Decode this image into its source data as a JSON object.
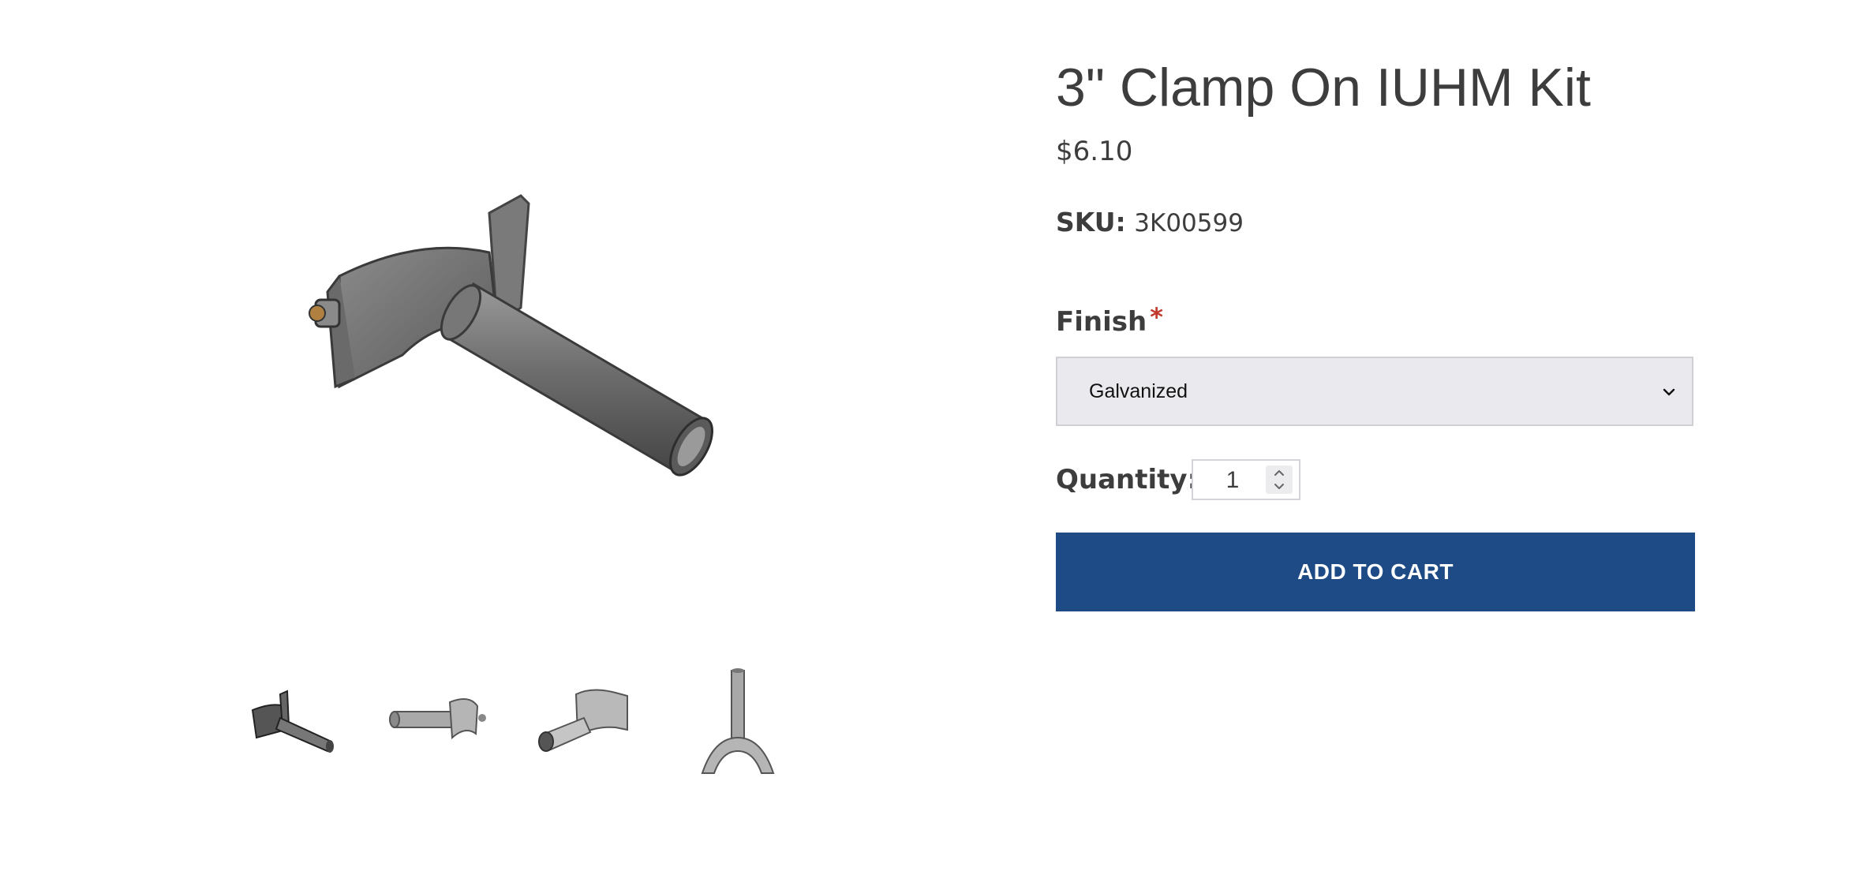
{
  "product": {
    "title": "3\" Clamp On IUHM Kit",
    "price": "$6.10",
    "sku_label": "SKU:",
    "sku_value": "3K00599"
  },
  "options": {
    "finish_label": "Finish",
    "required_marker": "*",
    "finish_selected": "Galvanized"
  },
  "quantity": {
    "label": "Quantity:",
    "value": "1"
  },
  "cart": {
    "button_label": "ADD TO CART"
  },
  "colors": {
    "button_bg": "#1e4b85",
    "required": "#c0392b",
    "select_bg": "#e9e9ee"
  }
}
